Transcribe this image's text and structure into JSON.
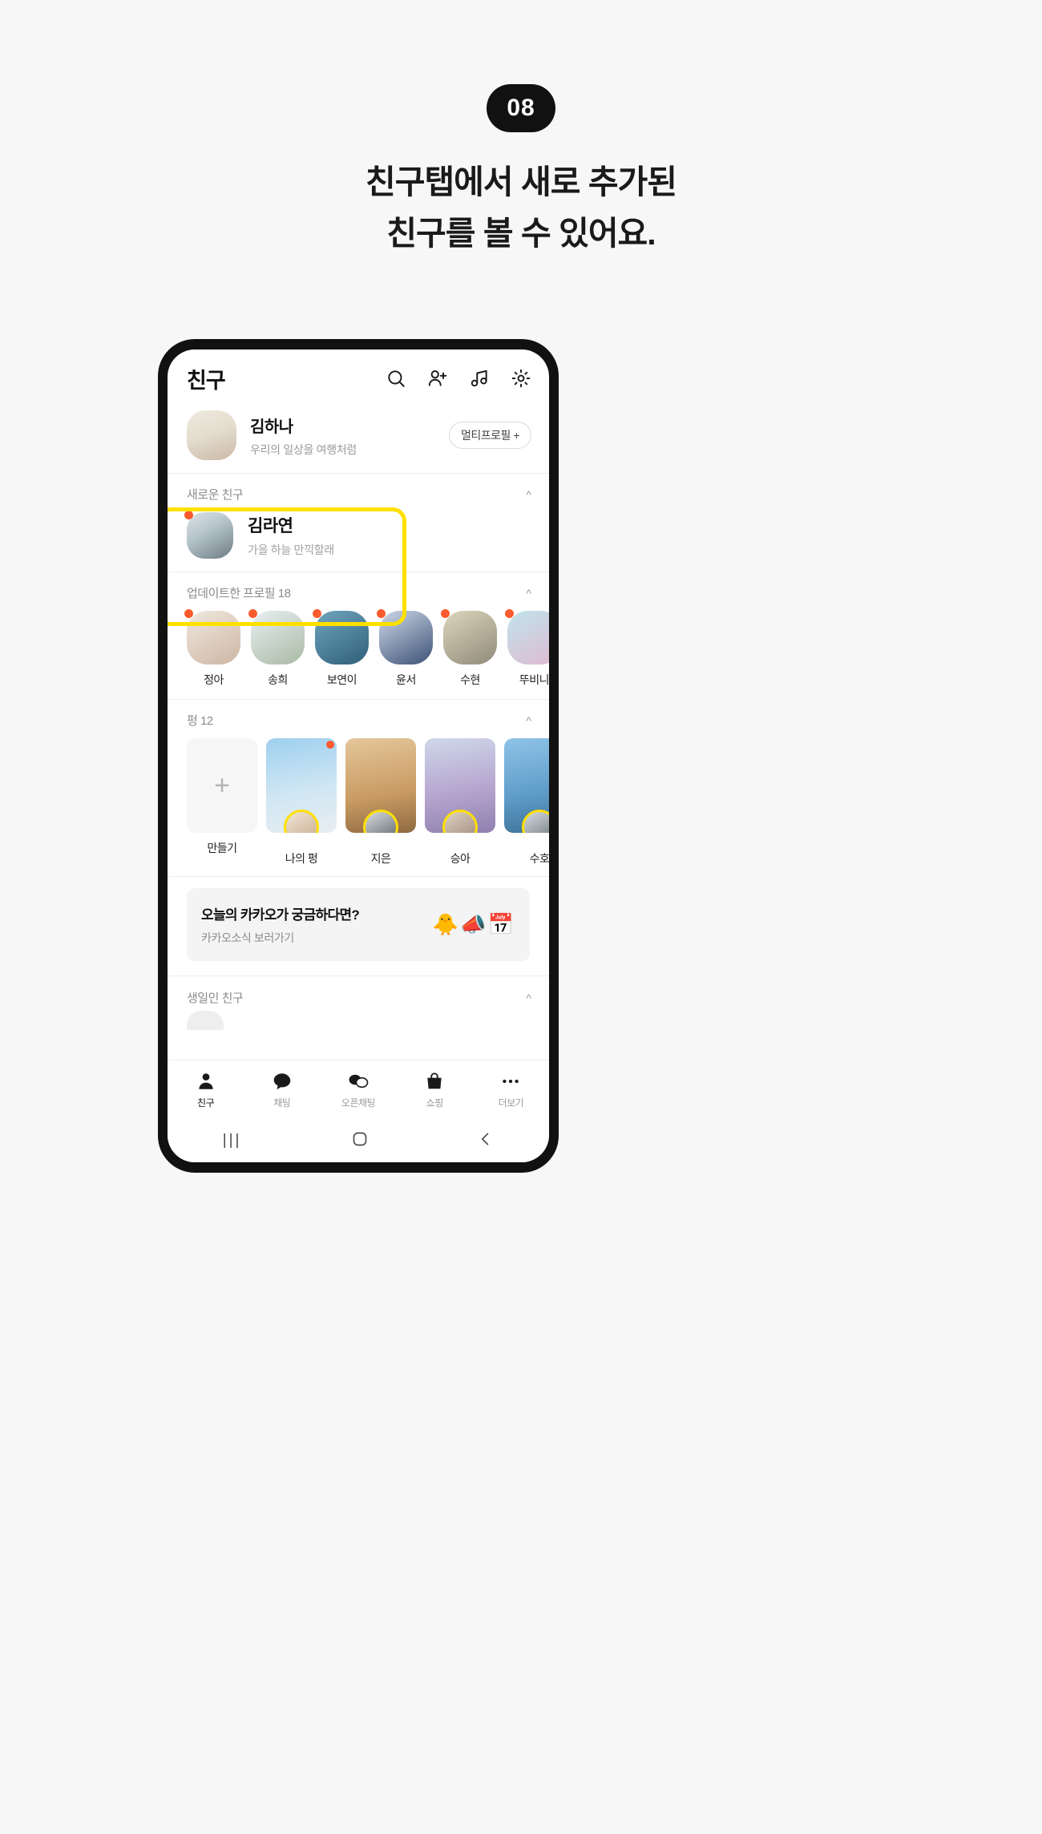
{
  "promo": {
    "badge": "08",
    "headline_line1": "친구탭에서 새로 추가된",
    "headline_line2": "친구를 볼 수 있어요."
  },
  "app": {
    "title": "친구",
    "header_icons": [
      "search-icon",
      "add-friend-icon",
      "music-icon",
      "settings-icon"
    ]
  },
  "my_profile": {
    "name": "김하나",
    "status_message": "우리의 일상을 여행처럼",
    "multiprofile_button": "멀티프로필 +"
  },
  "new_friends": {
    "section_title": "새로운 친구",
    "items": [
      {
        "name": "김라연",
        "status_message": "가을 하늘 만끽할래",
        "has_new_badge": true
      }
    ]
  },
  "updated_profiles": {
    "section_title": "업데이트한 프로필 18",
    "count": 18,
    "items": [
      {
        "name": "정아",
        "has_new_badge": true
      },
      {
        "name": "송희",
        "has_new_badge": true
      },
      {
        "name": "보연이",
        "has_new_badge": true
      },
      {
        "name": "윤서",
        "has_new_badge": true
      },
      {
        "name": "수현",
        "has_new_badge": true
      },
      {
        "name": "뚜비니",
        "has_new_badge": true
      },
      {
        "name": "",
        "has_new_badge": true
      }
    ]
  },
  "peong": {
    "section_title": "펑 12",
    "count": 12,
    "items": [
      {
        "name": "만들기",
        "type": "add"
      },
      {
        "name": "나의 펑",
        "type": "card",
        "has_new_badge": true
      },
      {
        "name": "지은",
        "type": "card",
        "has_new_badge": false
      },
      {
        "name": "승아",
        "type": "card",
        "has_new_badge": false
      },
      {
        "name": "수호",
        "type": "card",
        "has_new_badge": false
      }
    ]
  },
  "banner": {
    "title": "오늘의 카카오가 궁금하다면?",
    "subtitle": "카카오소식 보러가기",
    "emoji": "🐥📣📅"
  },
  "birthday": {
    "section_title": "생일인 친구"
  },
  "bottom_nav": {
    "items": [
      {
        "label": "친구",
        "icon": "person-icon",
        "active": true
      },
      {
        "label": "채팅",
        "icon": "chat-bubble-icon",
        "active": false
      },
      {
        "label": "오픈채팅",
        "icon": "open-chat-icon",
        "active": false
      },
      {
        "label": "쇼핑",
        "icon": "shopping-bag-icon",
        "active": false
      },
      {
        "label": "더보기",
        "icon": "more-dots-icon",
        "active": false
      }
    ]
  },
  "system_nav": {
    "recents": "|||",
    "home": "home-icon",
    "back": "back-icon"
  },
  "colors": {
    "accent": "#ffe000",
    "badge_dot": "#fc5b2e",
    "background": "#f7f7f7"
  }
}
